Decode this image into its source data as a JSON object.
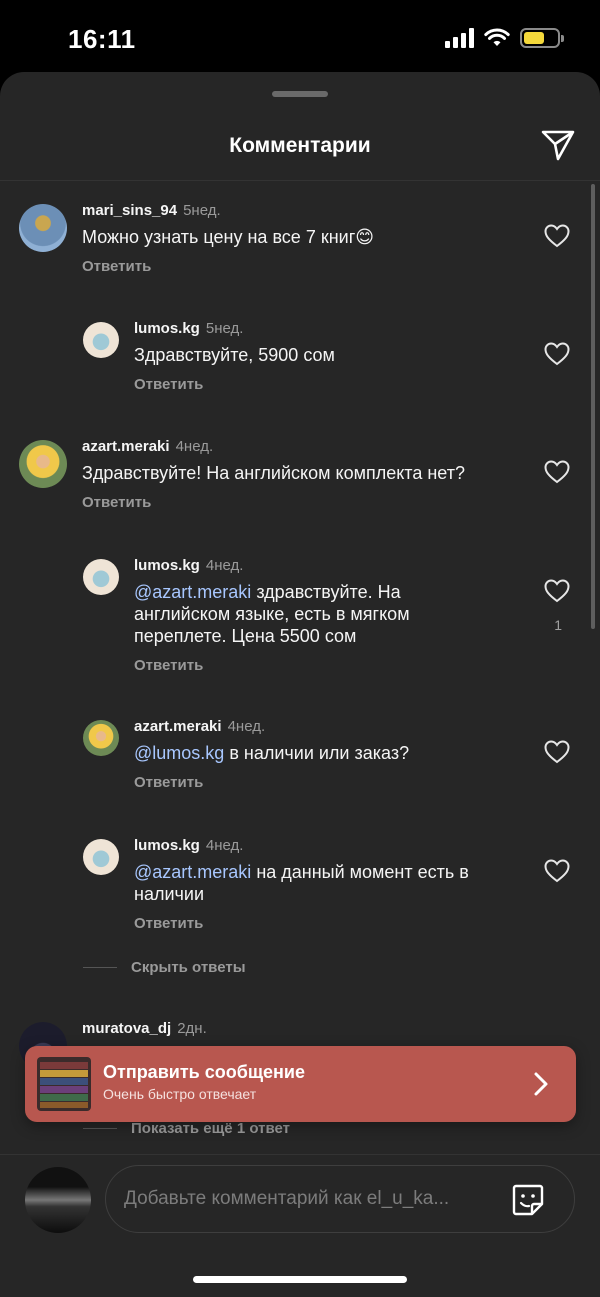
{
  "status_bar": {
    "time": "16:11"
  },
  "header": {
    "title": "Комментарии"
  },
  "comments": [
    {
      "user": "mari_sins_94",
      "time": "5нед.",
      "mention": "",
      "text": "Можно узнать цену на все 7 книг😊",
      "reply_label": "Ответить"
    },
    {
      "user": "lumos.kg",
      "time": "5нед.",
      "mention": "",
      "text": "Здравствуйте, 5900 сом",
      "reply_label": "Ответить"
    },
    {
      "user": "azart.meraki",
      "time": "4нед.",
      "mention": "",
      "text": "Здравствуйте! На английском комплекта нет?",
      "reply_label": "Ответить"
    },
    {
      "user": "lumos.kg",
      "time": "4нед.",
      "mention": "@azart.meraki",
      "text": " здравствуйте. На английском языке, есть в мягком переплете. Цена 5500 сом",
      "reply_label": "Ответить",
      "likes": "1"
    },
    {
      "user": "azart.meraki",
      "time": "4нед.",
      "mention": "@lumos.kg",
      "text": " в наличии или заказ?",
      "reply_label": "Ответить"
    },
    {
      "user": "lumos.kg",
      "time": "4нед.",
      "mention": "@azart.meraki",
      "text": " на данный момент есть в наличии",
      "reply_label": "Ответить"
    },
    {
      "user": "muratova_dj",
      "time": "2дн."
    }
  ],
  "hide_replies_label": "Скрыть ответы",
  "show_more_label": "Показать ещё 1 ответ",
  "banner": {
    "title": "Отправить сообщение",
    "subtitle": "Очень быстро отвечает",
    "color": "#b8574f"
  },
  "composer": {
    "placeholder": "Добавьте комментарий как el_u_ka..."
  }
}
